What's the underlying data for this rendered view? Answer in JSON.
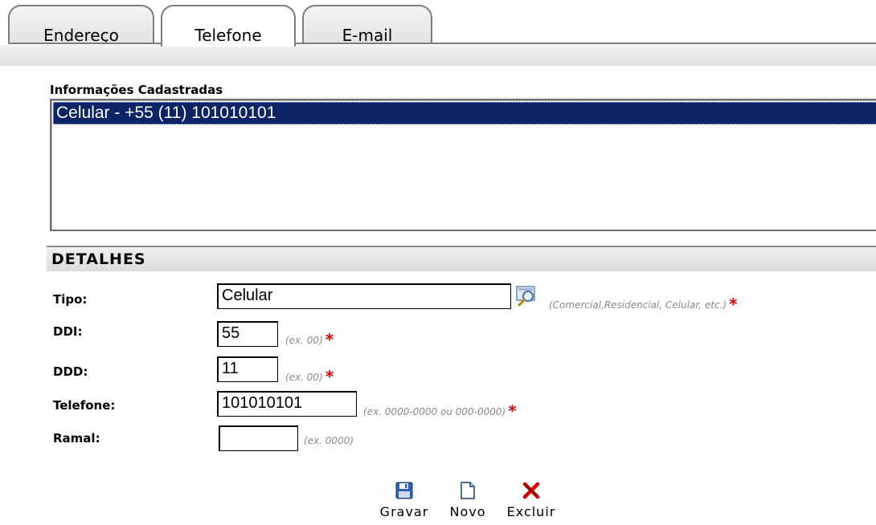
{
  "tabs": [
    {
      "label": "Endereço",
      "active": false
    },
    {
      "label": "Telefone",
      "active": true
    },
    {
      "label": "E-mail",
      "active": false
    }
  ],
  "registered": {
    "label": "Informações Cadastradas",
    "items": [
      "Celular - +55 (11) 101010101"
    ]
  },
  "details": {
    "title": "DETALHES",
    "tipo": {
      "label": "Tipo:",
      "value": "Celular",
      "hint": "(Comercial,Residencial, Celular, etc.)",
      "required_mark": "*"
    },
    "ddi": {
      "label": "DDI:",
      "value": "55",
      "hint": "(ex. 00)",
      "required_mark": "*"
    },
    "ddd": {
      "label": "DDD:",
      "value": "11",
      "hint": "(ex. 00)",
      "required_mark": "*"
    },
    "telefone": {
      "label": "Telefone:",
      "value": "101010101",
      "hint": "(ex. 0000-0000 ou 000-0000)",
      "required_mark": "*"
    },
    "ramal": {
      "label": "Ramal:",
      "value": "",
      "hint": "(ex. 0000)"
    }
  },
  "actions": {
    "save": {
      "label": "Gravar",
      "icon": "floppy-disk-icon"
    },
    "new": {
      "label": "Novo",
      "icon": "new-document-icon"
    },
    "delete": {
      "label": "Excluir",
      "icon": "delete-x-icon"
    }
  },
  "colors": {
    "selection": "#0b2465",
    "required": "#e60000",
    "hint": "#8a8a8a"
  }
}
